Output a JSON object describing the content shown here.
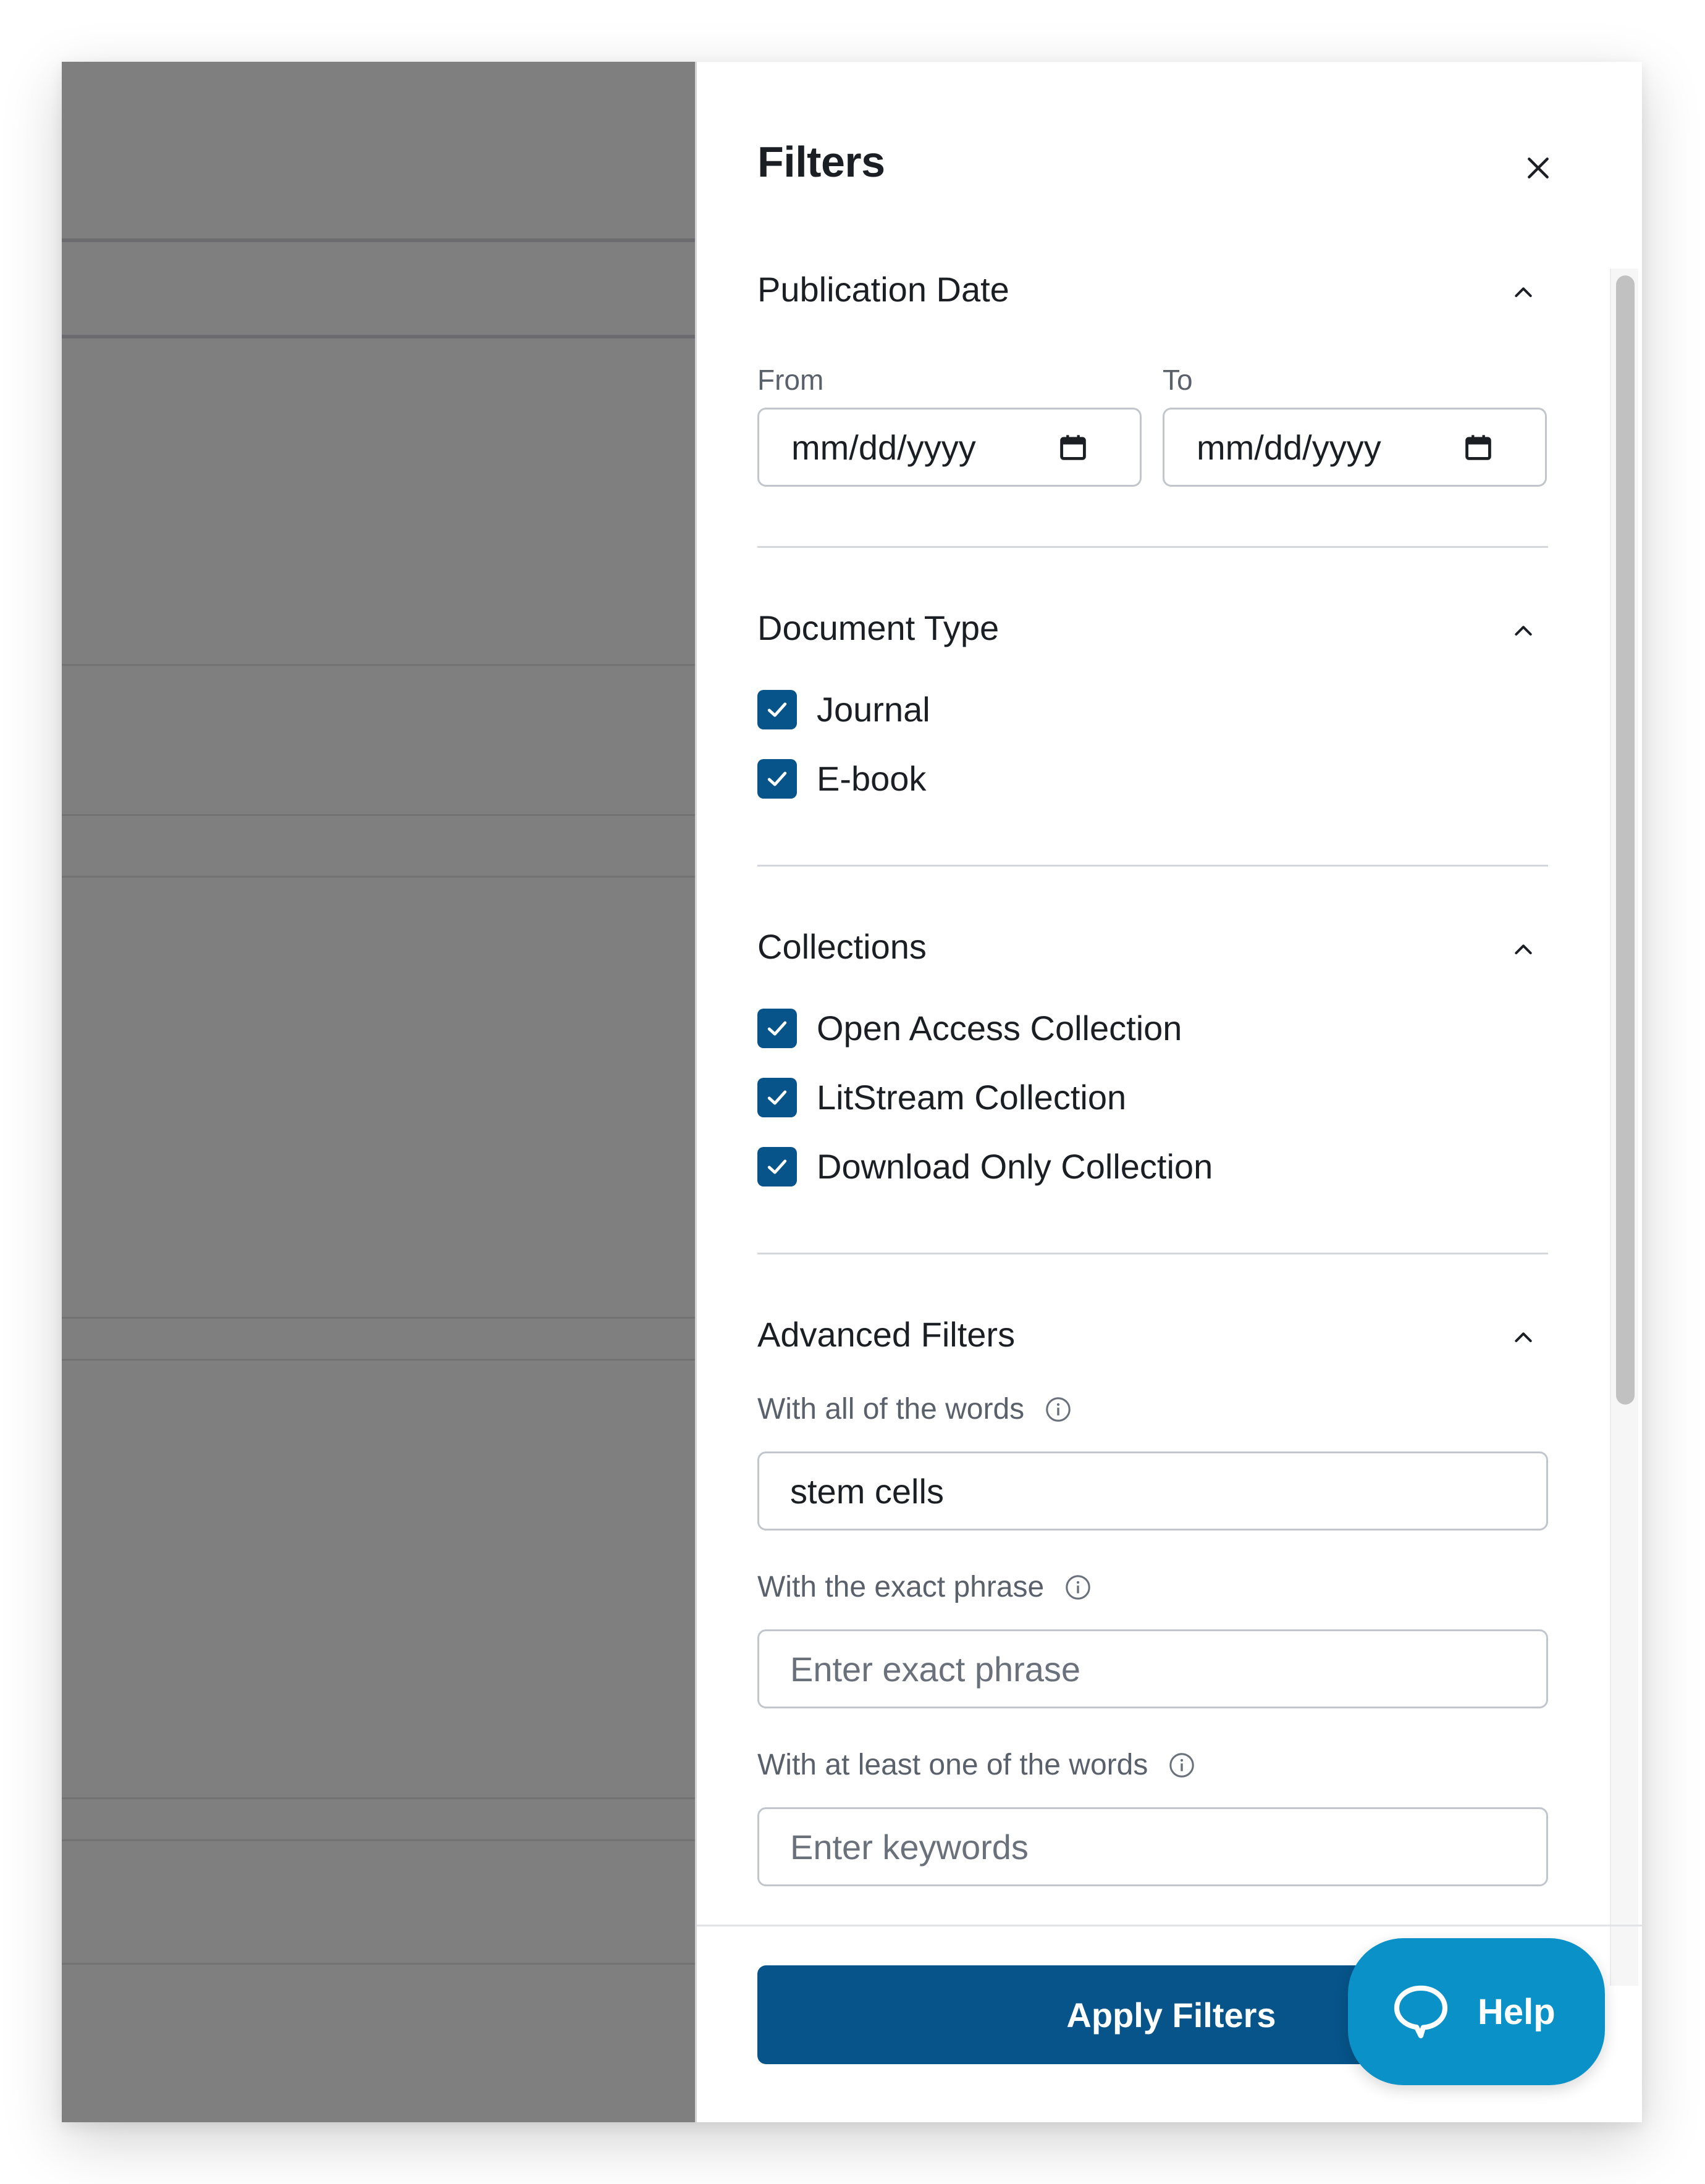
{
  "panel": {
    "title": "Filters",
    "close_icon": "close-icon"
  },
  "publication_date": {
    "title": "Publication Date",
    "from_label": "From",
    "to_label": "To",
    "from_value": "mm/dd/yyyy",
    "to_value": "mm/dd/yyyy",
    "calendar_icon": "calendar-icon"
  },
  "document_type": {
    "title": "Document Type",
    "options": [
      {
        "label": "Journal",
        "checked": true
      },
      {
        "label": "E-book",
        "checked": true
      }
    ]
  },
  "collections": {
    "title": "Collections",
    "options": [
      {
        "label": "Open Access Collection",
        "checked": true
      },
      {
        "label": "LitStream Collection",
        "checked": true
      },
      {
        "label": "Download Only Collection",
        "checked": true
      }
    ]
  },
  "advanced": {
    "title": "Advanced Filters",
    "all_words_label": "With all of the words",
    "all_words_value": "stem cells",
    "exact_phrase_label": "With the exact phrase",
    "exact_phrase_placeholder": "Enter exact phrase",
    "any_words_label": "With at least one of the words",
    "any_words_placeholder": "Enter keywords",
    "info_icon": "info-icon"
  },
  "footer": {
    "apply_label": "Apply Filters"
  },
  "help": {
    "label": "Help",
    "icon": "chat-bubble-icon"
  },
  "colors": {
    "accent": "#06548a",
    "help": "#0a91c8",
    "overlay": "#7f7f7f"
  }
}
